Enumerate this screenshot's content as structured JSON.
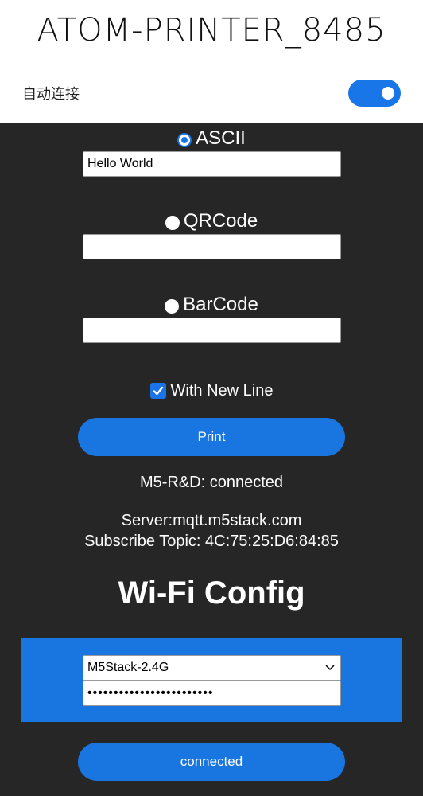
{
  "header": {
    "title": "ATOM-PRINTER_8485",
    "auto_connect_label": "自动连接",
    "auto_connect_on": true
  },
  "print_form": {
    "modes": [
      {
        "label": "ASCII",
        "selected": true,
        "value": "Hello World"
      },
      {
        "label": "QRCode",
        "selected": false,
        "value": ""
      },
      {
        "label": "BarCode",
        "selected": false,
        "value": ""
      }
    ],
    "new_line_label": "With New Line",
    "new_line_checked": true,
    "print_button": "Print"
  },
  "status": {
    "connection": "M5-R&D: connected",
    "server": "Server:mqtt.m5stack.com",
    "topic": "Subscribe Topic: 4C:75:25:D6:84:85"
  },
  "wifi": {
    "title": "Wi-Fi Config",
    "ssid": "M5Stack-2.4G",
    "password_mask": "••••••••••••••••••••••••",
    "button": "connected"
  },
  "colors": {
    "accent": "#1976e0",
    "panel_bg": "#262626",
    "header_bg": "#ffffff"
  },
  "icons": {
    "dropdown": "chevron-down-icon",
    "checkbox": "check-icon"
  }
}
